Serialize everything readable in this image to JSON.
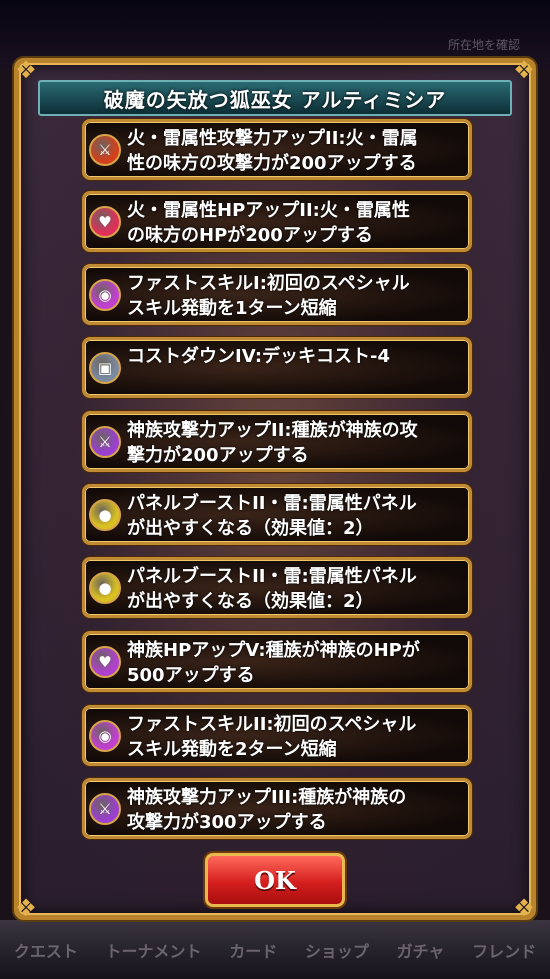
{
  "dialog": {
    "title": "破魔の矢放つ狐巫女 アルティミシア",
    "ok_label": "OK"
  },
  "background": {
    "top_label": "所在地を確認",
    "nav": [
      "クエスト",
      "トーナメント",
      "カード",
      "ショップ",
      "ガチャ",
      "フレンド"
    ]
  },
  "skills": [
    {
      "text": "火・雷属性攻撃力アップII:火・雷属\n性の味方の攻撃力が200アップする",
      "icon": "sword-icon",
      "icon_color": "#d2401c"
    },
    {
      "text": "火・雷属性HPアップII:火・雷属性\nの味方のHPが200アップする",
      "icon": "heart-icon",
      "icon_color": "#e0305a"
    },
    {
      "text": "ファストスキルI:初回のスペシャル\nスキル発動を1ターン短縮",
      "icon": "clock-icon",
      "icon_color": "#c040d0"
    },
    {
      "text": "コストダウンIV:デッキコスト-4",
      "icon": "deck-icon",
      "icon_color": "#7a8aa0"
    },
    {
      "text": "神族攻撃力アップII:種族が神族の攻\n撃力が200アップする",
      "icon": "sword-icon",
      "icon_color": "#9a40d0"
    },
    {
      "text": "パネルブーストII・雷:雷属性パネル\nが出やすくなる（効果値：2）",
      "icon": "panel-icon",
      "icon_color": "#d8c020"
    },
    {
      "text": "パネルブーストII・雷:雷属性パネル\nが出やすくなる（効果値：2）",
      "icon": "panel-icon",
      "icon_color": "#d8c020"
    },
    {
      "text": "神族HPアップV:種族が神族のHPが\n500アップする",
      "icon": "heart-icon",
      "icon_color": "#b040d0"
    },
    {
      "text": "ファストスキルII:初回のスペシャル\nスキル発動を2ターン短縮",
      "icon": "clock-icon",
      "icon_color": "#c040d0"
    },
    {
      "text": "神族攻撃力アップIII:種族が神族の\n攻撃力が300アップする",
      "icon": "sword-icon",
      "icon_color": "#9a40d0"
    }
  ]
}
